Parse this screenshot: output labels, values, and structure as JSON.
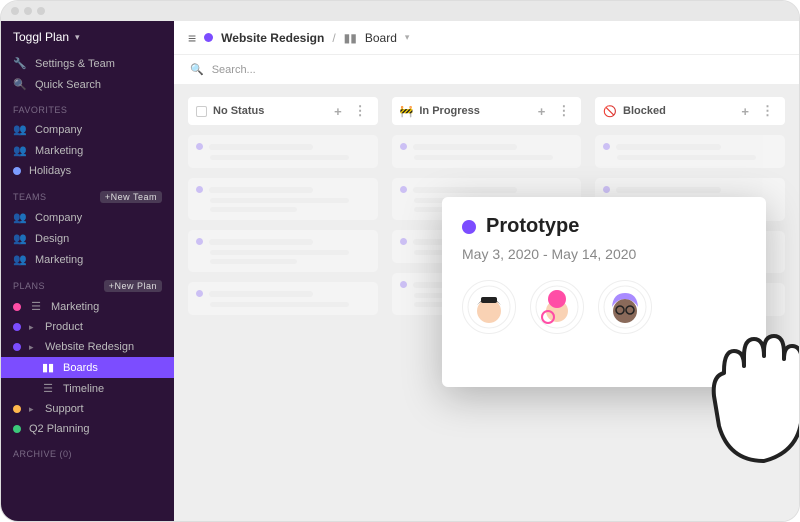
{
  "app": {
    "name": "Toggl Plan"
  },
  "sidebar": {
    "settings_label": "Settings & Team",
    "quicksearch_label": "Quick Search",
    "favorites_heading": "FAVORITES",
    "favorites": [
      {
        "label": "Company",
        "icon": "users"
      },
      {
        "label": "Marketing",
        "icon": "users"
      },
      {
        "label": "Holidays",
        "icon": "dot",
        "color": "#7c9cff"
      }
    ],
    "teams_heading": "TEAMS",
    "new_team_label": "+New Team",
    "teams": [
      {
        "label": "Company"
      },
      {
        "label": "Design"
      },
      {
        "label": "Marketing"
      }
    ],
    "plans_heading": "PLANS",
    "new_plan_label": "+New Plan",
    "plans": [
      {
        "label": "Marketing",
        "color": "#ff4da6"
      },
      {
        "label": "Product",
        "color": "#7c4dff",
        "children": []
      },
      {
        "label": "Website Redesign",
        "color": "#7c4dff",
        "children": [
          {
            "label": "Boards",
            "icon": "board",
            "active": true
          },
          {
            "label": "Timeline",
            "icon": "timeline"
          }
        ]
      },
      {
        "label": "Support",
        "color": "#ffb84d"
      },
      {
        "label": "Q2 Planning",
        "color": "#3cc97a"
      }
    ],
    "archive_heading": "ARCHIVE (0)"
  },
  "toolbar": {
    "breadcrumb_project": "Website Redesign",
    "breadcrumb_view": "Board",
    "separator": "/"
  },
  "search": {
    "placeholder": "Search..."
  },
  "board": {
    "columns": [
      {
        "name": "No Status",
        "icon": "square"
      },
      {
        "name": "In Progress",
        "icon": "construction"
      },
      {
        "name": "Blocked",
        "icon": "blocked"
      }
    ]
  },
  "poster": {
    "title": "Prototype",
    "date_range": "May 3, 2020 - May 14, 2020"
  }
}
